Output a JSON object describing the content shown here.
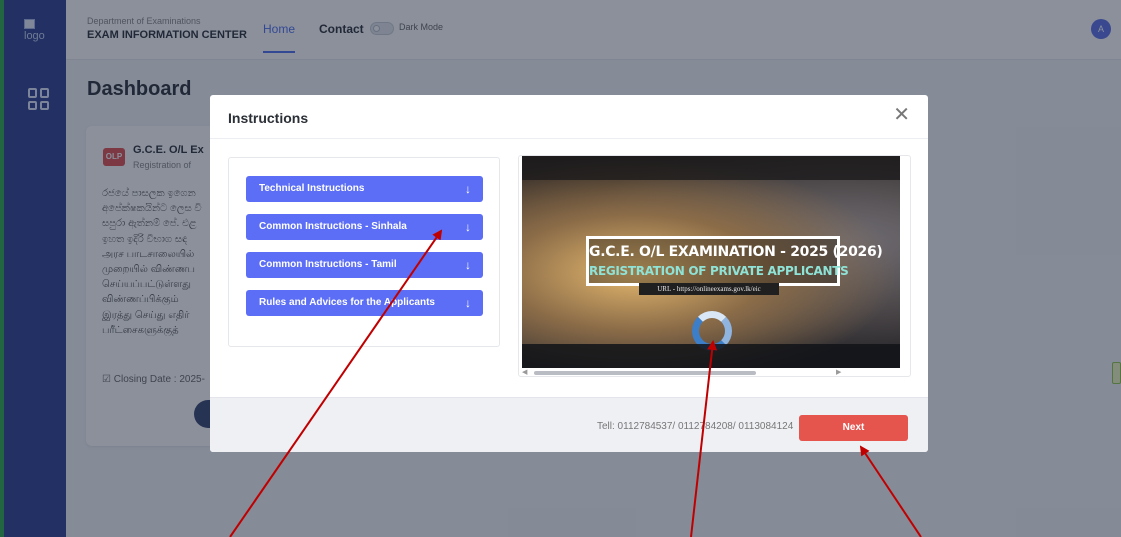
{
  "sidebar": {
    "logo_alt": "logo"
  },
  "header": {
    "department": "Department of Examinations",
    "title": "EXAM INFORMATION CENTER",
    "nav": {
      "home": "Home",
      "contact": "Contact"
    },
    "dark_mode_label": "Dark Mode",
    "avatar_initial": "A"
  },
  "page": {
    "title": "Dashboard",
    "card": {
      "badge": "OLP",
      "title": "G.C.E. O/L Ex",
      "subtitle": "Registration of",
      "lines": [
        "රජයේ පාසලක ඉගෙන",
        "අපේක්ෂකයින්ට ලෙස වි",
        "සපුරා ඇත්නම් පේ. එළ",
        "ඉහත ඉදිරි වීභාග සඳ",
        "அரச பாடசாலையில்",
        "முறையில் விண்ணப",
        "செய்யப்பட்டுள்ளது",
        "விண்ணப்பிக்கும்",
        "இரத்து செய்து எதிர்",
        "பரீட்சைகளுக்குத்"
      ],
      "closing": "Closing Date : 2025-"
    }
  },
  "modal": {
    "title": "Instructions",
    "instructions": [
      "Technical Instructions",
      "Common Instructions - Sinhala",
      "Common Instructions - Tamil",
      "Rules and Advices for the Applicants"
    ],
    "video": {
      "title": "G.C.E. O/L EXAMINATION - 2025 (2026)",
      "subtitle": "REGISTRATION OF PRIVATE APPLICANTS",
      "url": "URL - https://onlineexams.gov.lk/eic"
    },
    "tel": "Tell: 0112784537/ 0112784208/ 0113084124",
    "next_label": "Next"
  },
  "colors": {
    "sidebar": "#2c3e8f",
    "accent": "#5b6ef5",
    "next": "#e5544d",
    "annotation_arrow": "#c00000"
  }
}
